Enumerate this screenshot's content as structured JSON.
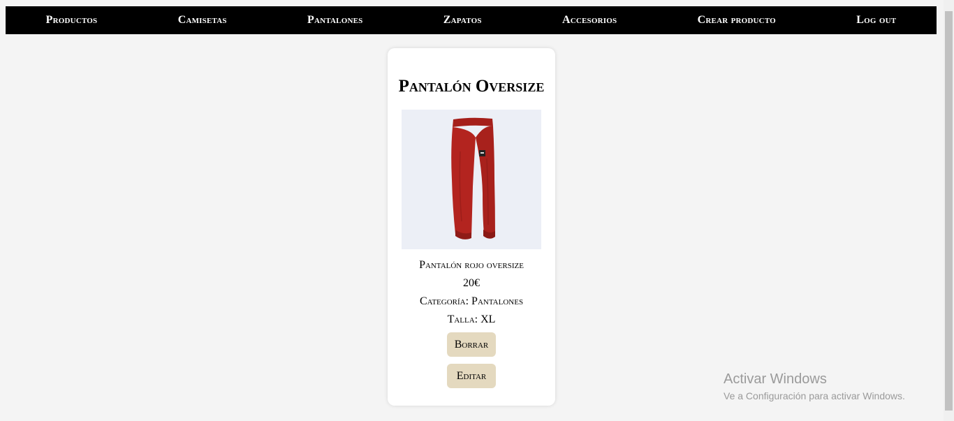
{
  "nav": {
    "items": [
      {
        "label": "Productos"
      },
      {
        "label": "Camisetas"
      },
      {
        "label": "Pantalones"
      },
      {
        "label": "Zapatos"
      },
      {
        "label": "Accesorios"
      },
      {
        "label": "Crear producto"
      },
      {
        "label": "Log out"
      }
    ]
  },
  "product": {
    "title": "Pantalón Oversize",
    "description": "Pantalón rojo oversize",
    "price": "20€",
    "category": "Categoría: Pantalones",
    "size": "Talla: XL",
    "image_icon": "red-pants-image",
    "image_background": "#eceff6",
    "pants_color": "#b3241f"
  },
  "actions": {
    "delete_label": "Borrar",
    "edit_label": "Editar",
    "button_color": "#e4d9bf"
  },
  "watermark": {
    "title": "Activar Windows",
    "subtitle": "Ve a Configuración para activar Windows."
  }
}
